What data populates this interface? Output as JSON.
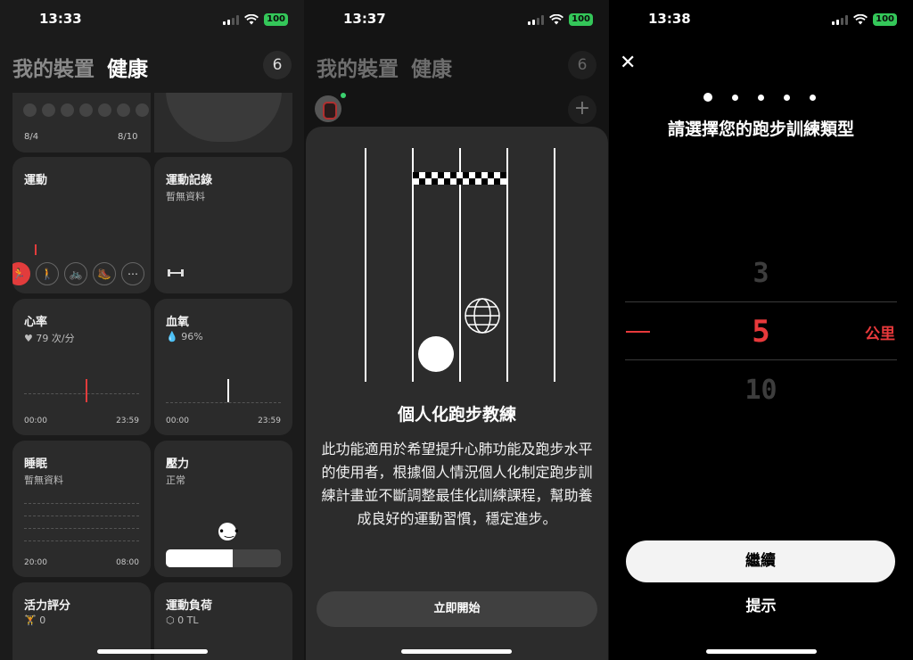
{
  "status": [
    {
      "time": "13:33",
      "battery": "100"
    },
    {
      "time": "13:37",
      "battery": "100"
    },
    {
      "time": "13:38",
      "battery": "100"
    }
  ],
  "screen1": {
    "tab_devices": "我的裝置",
    "tab_health": "健康",
    "badge": "6",
    "top_card": {
      "date_start": "8/4",
      "date_end": "8/10"
    },
    "exercise": {
      "title": "運動",
      "icons": [
        "running-icon",
        "walking-icon",
        "cycling-icon",
        "hiking-icon",
        "more-activity-icon"
      ]
    },
    "exercise_record": {
      "title": "運動記錄",
      "subtitle": "暫無資料"
    },
    "heart_rate": {
      "title": "心率",
      "value": "79 次/分",
      "t_start": "00:00",
      "t_end": "23:59"
    },
    "spo2": {
      "title": "血氧",
      "value": "96%",
      "t_start": "00:00",
      "t_end": "23:59"
    },
    "sleep": {
      "title": "睡眠",
      "subtitle": "暫無資料",
      "t_start": "20:00",
      "t_end": "08:00"
    },
    "stress": {
      "title": "壓力",
      "subtitle": "正常"
    },
    "vitality": {
      "title": "活力評分",
      "value": "0"
    },
    "training_load": {
      "title": "運動負荷",
      "value": "0 TL"
    }
  },
  "screen2": {
    "tab_devices": "我的裝置",
    "tab_health": "健康",
    "badge": "6",
    "sheet_title": "個人化跑步教練",
    "sheet_body": "此功能適用於希望提升心肺功能及跑步水平的使用者，根據個人情況個人化制定跑步訓練計畫並不斷調整最佳化訓練課程，幫助養成良好的運動習慣，穩定進步。",
    "start_button": "立即開始"
  },
  "screen3": {
    "title": "請選擇您的跑步訓練類型",
    "options": [
      "3",
      "5",
      "10"
    ],
    "selected": "5",
    "unit": "公里",
    "continue_button": "繼續",
    "tip_link": "提示",
    "accent": "#e8393b"
  }
}
